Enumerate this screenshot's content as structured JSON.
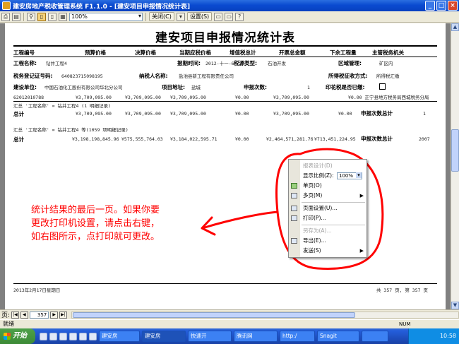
{
  "window": {
    "title": "建安房地产税收管理系统 F1.1.0 - [建安项目申报情况统计表]",
    "buttons": [
      "_",
      "□",
      "×"
    ]
  },
  "toolbar": {
    "zoom_value": "100%",
    "close_label": "关闭(C)",
    "setup_label": "设置(S)"
  },
  "report": {
    "title": "建安项目申报情况统计表",
    "columns": [
      "工程编号",
      "预算价格",
      "决算价格",
      "当期应税价格",
      "增值税总计",
      "开票总金额",
      "下余工程量",
      "主管税务机关"
    ],
    "project": {
      "name_label": "工程名称:",
      "name_value": "钻井工程4",
      "period_label": "报期时间:",
      "period_value": "2012-十一-6",
      "tax_source_label": "税源类型:",
      "tax_source_value": "石油开发",
      "region_label": "区域管理:",
      "region_value": "矿区内",
      "tax_reg_label": "税务登记证号码:",
      "tax_reg_value": "640823715098195",
      "taxpayer_label": "纳税人名称:",
      "taxpayer_value": "盐池县新工程有限责任公司",
      "collect_label": "所得税征收方式:",
      "collect_value": "所得税汇缴",
      "builder_label": "建设单位:",
      "builder_value": "中国石油化工股份有限公司华北分公司",
      "location_label": "项目地址:",
      "location_value": "盐城",
      "declare_label": "申报次数:",
      "declare_value": "1",
      "stamp_label": "印花税是否已缴:"
    },
    "detail_row": {
      "code": "62012010788",
      "budget": "¥3,709,095.00",
      "final": "¥3,709,095.00",
      "taxable": "¥3,709,095.00",
      "vat": "¥0.00",
      "invoice": "¥3,709,095.00",
      "remaining": "¥0.00",
      "office": "¥0.00 正宁县地方税务局西城税务分局"
    },
    "group1": {
      "header": "汇总 '工程名称' = 钻井工程4 (1 明细记录)",
      "total_label": "总计",
      "budget": "¥3,709,095.00",
      "final": "¥3,709,095.00",
      "taxable": "¥3,709,095.00",
      "vat": "¥0.00",
      "invoice": "¥3,709,095.00",
      "remaining": "¥0.00",
      "count_label": "申报次数总计",
      "count_value": "1"
    },
    "group2": {
      "header": "汇总 '工程名称' = 钻井工程4 等(1059 项明细记录)",
      "total_label": "总计",
      "budget": "¥3,198,198,845.96",
      "final": "¥575,555,764.03",
      "taxable": "¥3,184,022,595.71",
      "vat": "¥0.00",
      "invoice": "¥2,464,571,281.76",
      "remaining": "¥713,451,224.95",
      "count_label": "申报次数总计",
      "count_value": "2007"
    },
    "footer": {
      "date": "2013年2月17日星期日",
      "pages": "共 357 页, 第 357 页"
    }
  },
  "annotation": {
    "line1": "统计结果的最后一页。如果你要",
    "line2": "更改打印机设置，请点击右键，",
    "line3": "如右图所示，点打印就可更改。"
  },
  "context_menu": {
    "design": "报表设计(D)",
    "zoom_label": "显示比例(Z):",
    "zoom_value": "100%",
    "single": "单页(O)",
    "multi": "多页(M)",
    "page_setup": "页面设置(U)...",
    "print": "打印(P)...",
    "save_as": "另存为(A)...",
    "export": "导出(E)...",
    "send": "发送(S)"
  },
  "nav": {
    "page_label": "页:",
    "page_value": "357"
  },
  "status": {
    "text": "就绪",
    "num": "NUM"
  },
  "taskbar": {
    "start": "开始",
    "tasks": [
      "建安房",
      "建安房",
      "快速开",
      "腾讯网",
      "http:/",
      "Snagit",
      ""
    ],
    "clock": "10:58"
  }
}
